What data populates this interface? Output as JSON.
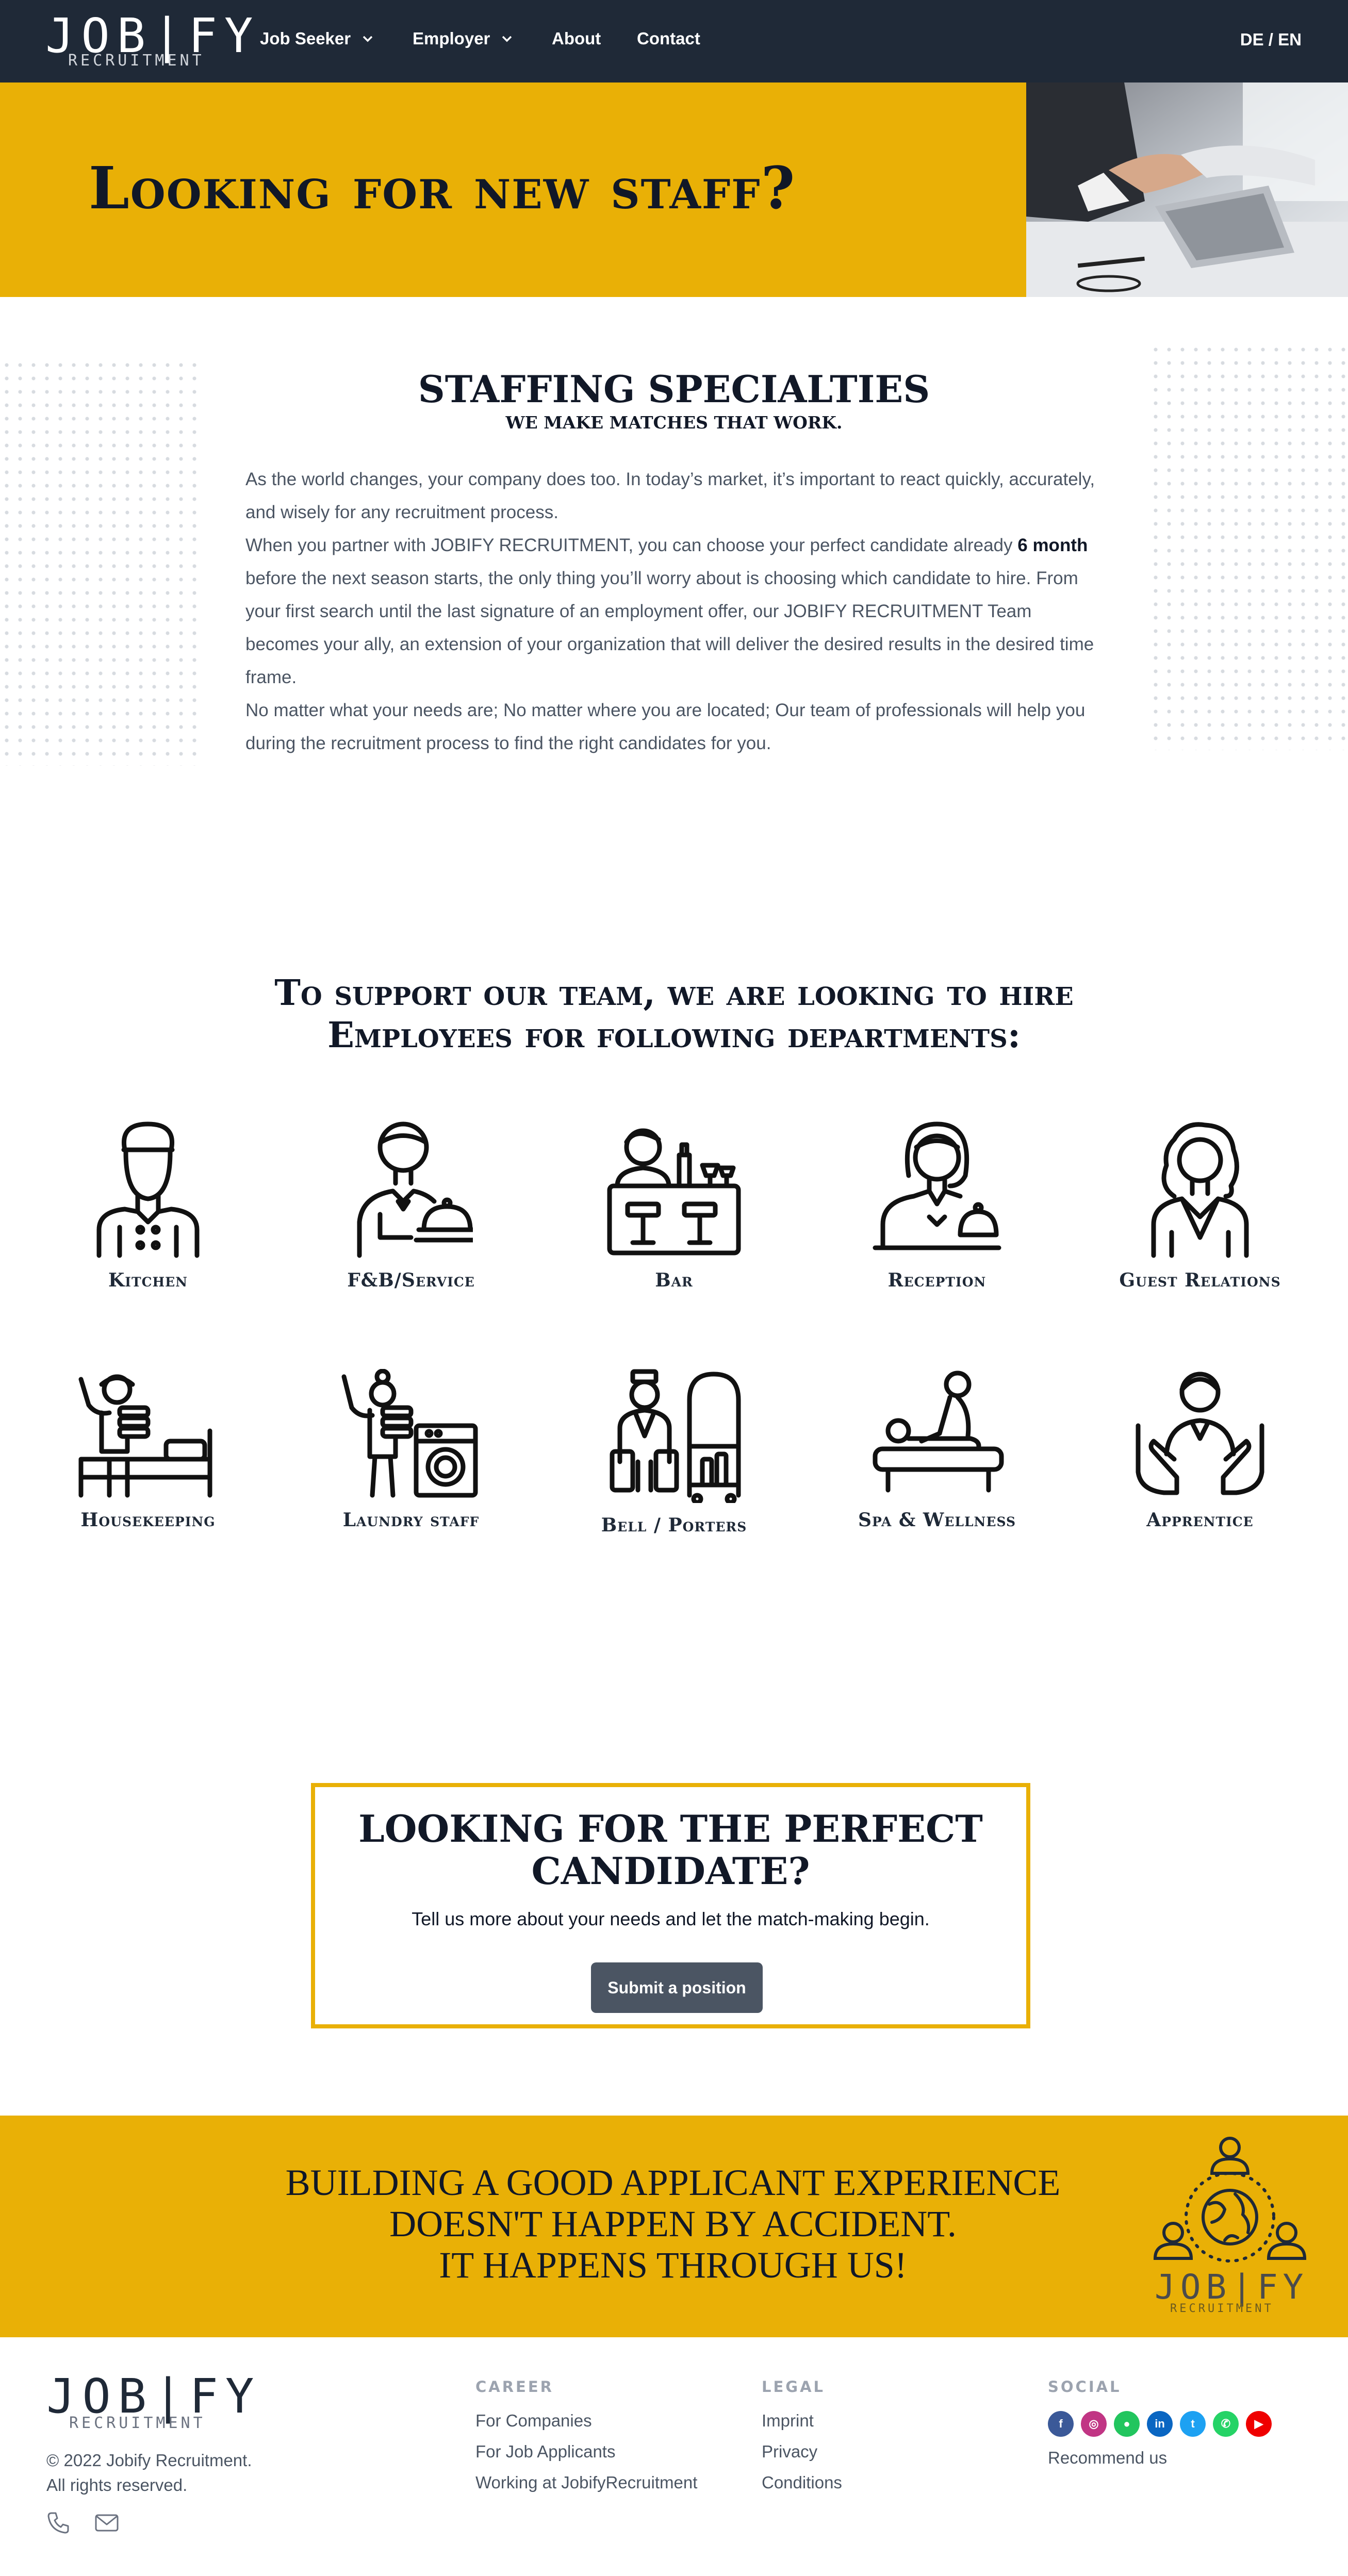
{
  "header": {
    "logo_main": "JOB|FY",
    "logo_sub": "RECRUITMENT",
    "nav": [
      {
        "label": "Job Seeker"
      },
      {
        "label": "Employer"
      },
      {
        "label": "About"
      },
      {
        "label": "Contact"
      }
    ],
    "language": "DE / EN"
  },
  "hero": {
    "title": "Looking for new staff?"
  },
  "specialties": {
    "title": "STAFFING SPECIALTIES",
    "subtitle": "WE MAKE MATCHES THAT WORK.",
    "p1": "As the world changes, your company does too. In today’s market, it’s important to react quickly, accurately, and wisely for any recruitment process.",
    "p2_before": "When you partner with JOBIFY RECRUITMENT, you can choose your perfect candidate already ",
    "p2_bold": "6 month",
    "p2_after": " before the next season starts, the only thing you’ll worry about is choosing which candidate to hire. From your first search until the last signature of an employment offer, our JOBIFY RECRUITMENT Team becomes your ally, an extension of your organization that will deliver the desired results in the desired time frame.",
    "p3": "No matter what your needs are; No matter where you are located; Our team of professionals will help you during the recruitment process to find the right candidates for you."
  },
  "departments": {
    "title_line1": "To support our team, we are looking to hire",
    "title_line2": "Employees for following departments:",
    "items": [
      {
        "label": "Kitchen",
        "icon": "chef-icon"
      },
      {
        "label": "F&B/Service",
        "icon": "waiter-icon"
      },
      {
        "label": "Bar",
        "icon": "bartender-icon"
      },
      {
        "label": "Reception",
        "icon": "receptionist-icon"
      },
      {
        "label": "Guest Relations",
        "icon": "guest-relations-icon"
      },
      {
        "label": "Housekeeping",
        "icon": "housekeeper-icon"
      },
      {
        "label": "Laundry staff",
        "icon": "laundry-icon"
      },
      {
        "label": "Bell / Porters",
        "icon": "bellboy-icon"
      },
      {
        "label": "Spa & Wellness",
        "icon": "massage-icon"
      },
      {
        "label": "Apprentice",
        "icon": "apprentice-icon"
      }
    ]
  },
  "cta": {
    "title_line1": "LOOKING FOR THE PERFECT",
    "title_line2": "CANDIDATE?",
    "text": "Tell us more about your needs and let the match-making begin.",
    "button": "Submit a position"
  },
  "banner": {
    "line1": "BUILDING A GOOD APPLICANT EXPERIENCE",
    "line2": "DOESN'T HAPPEN BY ACCIDENT.",
    "line3": "IT HAPPENS THROUGH US!",
    "logo_main": "JOB|FY",
    "logo_sub": "RECRUITMENT"
  },
  "footer": {
    "logo_main": "JOB|FY",
    "logo_sub": "RECRUITMENT",
    "copyright_line1": "© 2022 Jobify Recruitment.",
    "copyright_line2": "All rights reserved.",
    "career": {
      "heading": "CAREER",
      "links": [
        "For Companies",
        "For Job Applicants",
        "Working at JobifyRecruitment"
      ]
    },
    "legal": {
      "heading": "LEGAL",
      "links": [
        "Imprint",
        "Privacy",
        "Conditions"
      ]
    },
    "social": {
      "heading": "SOCIAL",
      "networks": [
        {
          "name": "facebook-icon",
          "glyph": "f",
          "color": "#3b5998"
        },
        {
          "name": "instagram-icon",
          "glyph": "◎",
          "color": "#c13584"
        },
        {
          "name": "line-icon",
          "glyph": "●",
          "color": "#22c55e"
        },
        {
          "name": "linkedin-icon",
          "glyph": "in",
          "color": "#0a66c2"
        },
        {
          "name": "twitter-icon",
          "glyph": "t",
          "color": "#1da1f2"
        },
        {
          "name": "whatsapp-icon",
          "glyph": "✆",
          "color": "#25d366"
        },
        {
          "name": "youtube-icon",
          "glyph": "▶",
          "color": "#ef0000"
        }
      ],
      "recommend": "Recommend us"
    }
  },
  "colors": {
    "accent": "#e9b006",
    "header_bg": "#1f2937",
    "button": "#4b5563"
  }
}
